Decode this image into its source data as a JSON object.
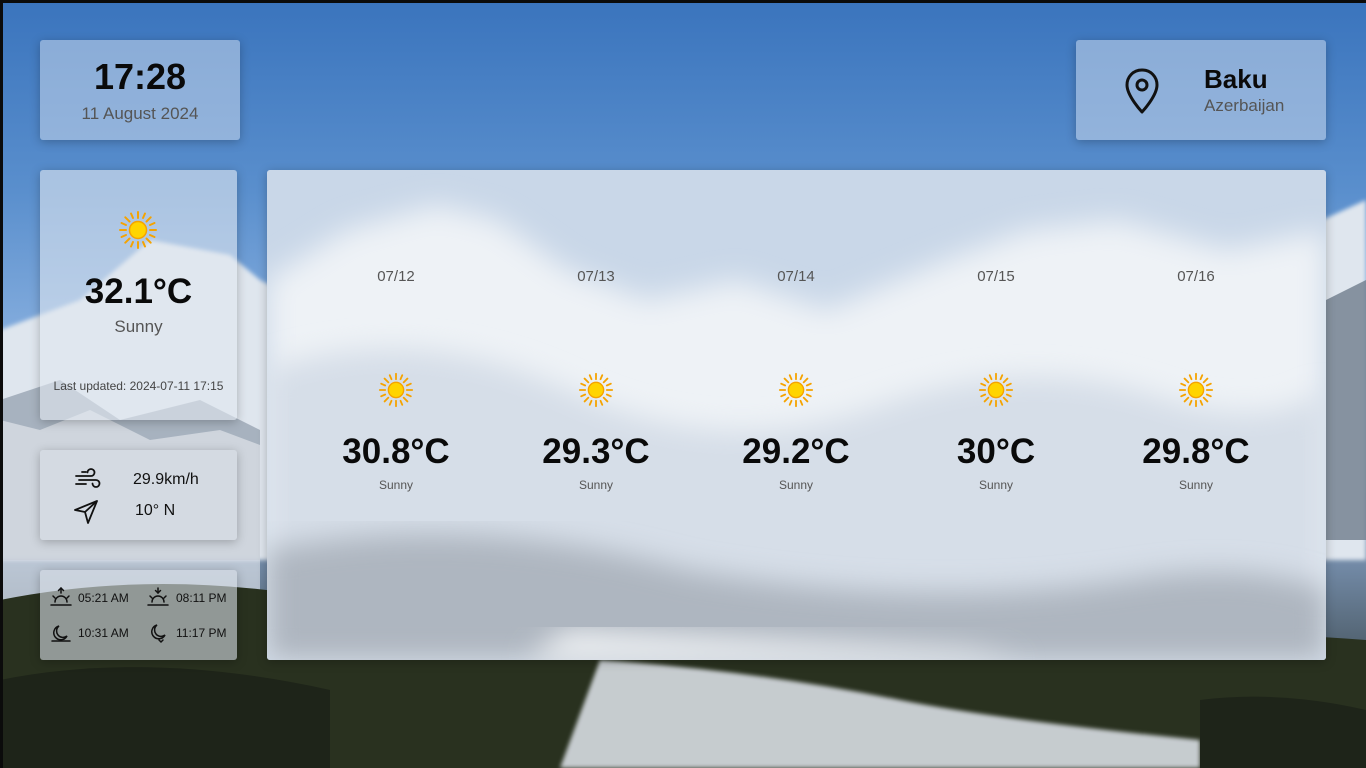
{
  "clock": {
    "time": "17:28",
    "date": "11 August 2024"
  },
  "location": {
    "city": "Baku",
    "country": "Azerbaijan",
    "icon": "map-pin-icon"
  },
  "current": {
    "icon": "sun-icon",
    "temperature": "32.1°C",
    "condition": "Sunny",
    "last_updated": "Last updated: 2024-07-11 17:15"
  },
  "wind": {
    "speed": "29.9km/h",
    "direction": "10° N",
    "speed_icon": "wind-icon",
    "direction_icon": "navigation-arrow-icon"
  },
  "astro": {
    "sunrise": "05:21 AM",
    "sunset": "08:11 PM",
    "moonrise": "10:31 AM",
    "moonset": "11:17 PM"
  },
  "forecast": [
    {
      "date": "07/12",
      "temperature": "30.8°C",
      "condition": "Sunny"
    },
    {
      "date": "07/13",
      "temperature": "29.3°C",
      "condition": "Sunny"
    },
    {
      "date": "07/14",
      "temperature": "29.2°C",
      "condition": "Sunny"
    },
    {
      "date": "07/15",
      "temperature": "30°C",
      "condition": "Sunny"
    },
    {
      "date": "07/16",
      "temperature": "29.8°C",
      "condition": "Sunny"
    }
  ],
  "colors": {
    "sun_core": "#ffd400",
    "sun_rays": "#f5a300",
    "panel_glass": "#c8d7eb"
  }
}
